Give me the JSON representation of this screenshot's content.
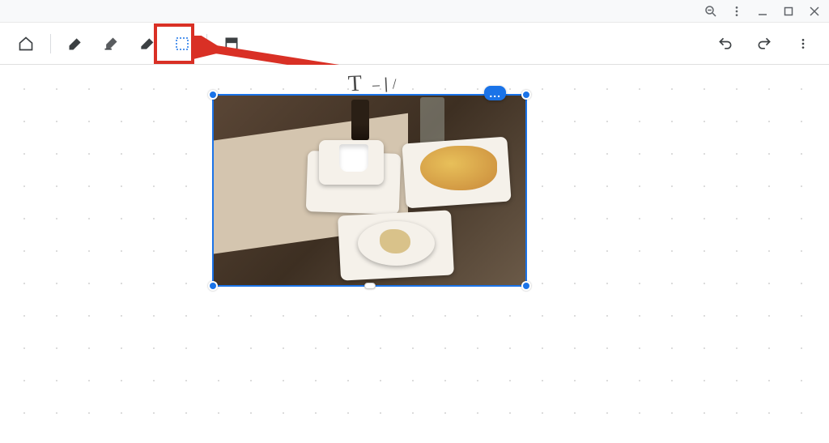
{
  "window": {
    "zoom_tooltip": "Zoom",
    "menu_tooltip": "Menu",
    "minimize_tooltip": "Minimize",
    "maximize_tooltip": "Maximize",
    "close_tooltip": "Close"
  },
  "toolbar": {
    "home_label": "Home",
    "pen_label": "Pen",
    "highlighter_label": "Highlighter",
    "eraser_label": "Eraser",
    "select_label": "Select",
    "insert_label": "Insert image",
    "undo_label": "Undo",
    "redo_label": "Redo",
    "more_label": "More"
  },
  "canvas": {
    "image_alt": "Photograph of breakfast plates and a cup on a wooden table",
    "sketch_text": "T",
    "image_menu_label": "...",
    "selected": true
  },
  "annotation": {
    "highlight_target": "select-tool",
    "highlight_color": "#d93025",
    "arrow_color": "#d93025"
  }
}
